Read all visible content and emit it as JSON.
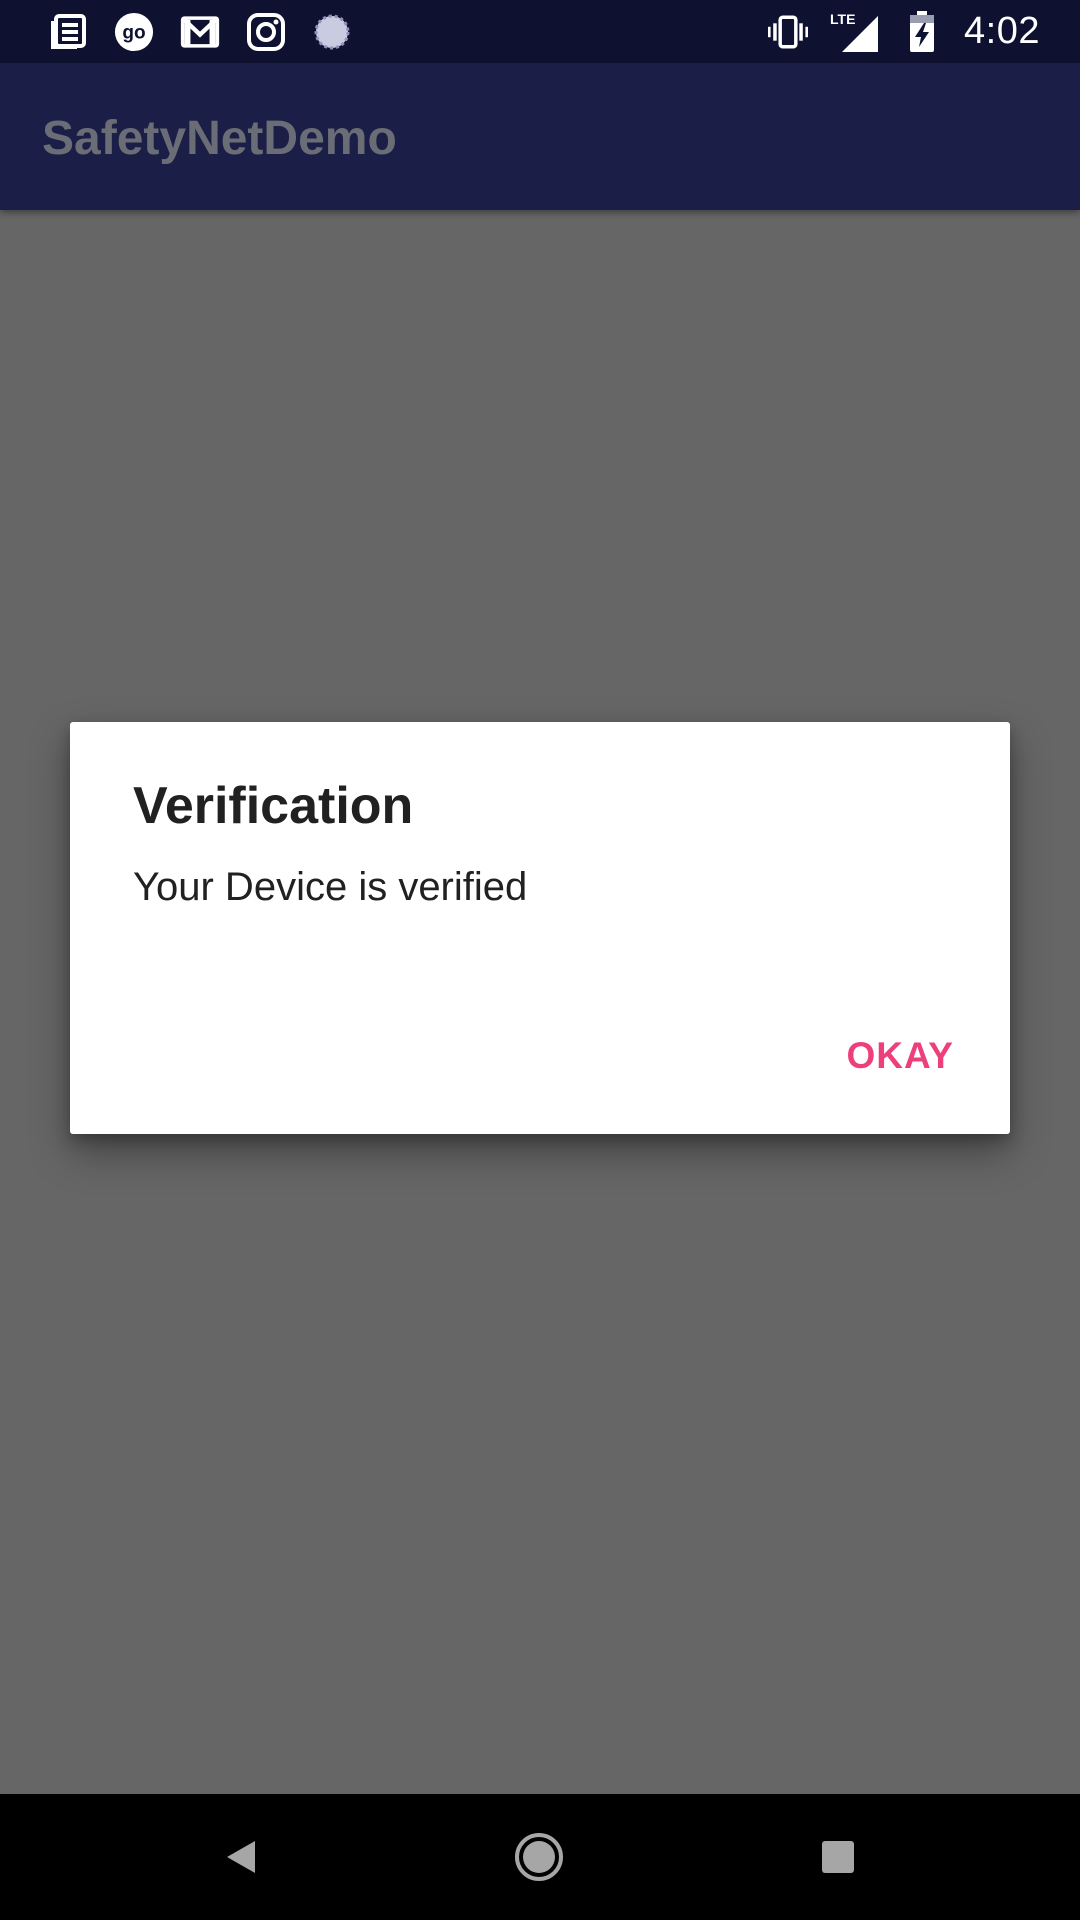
{
  "status_bar": {
    "time": "4:02",
    "network_label": "LTE",
    "notification_icons": [
      "news-icon",
      "go-icon",
      "gmail-icon",
      "instagram-icon",
      "sync-spinner-icon"
    ],
    "system_icons": [
      "vibrate-icon",
      "lte-signal-icon",
      "battery-charging-icon"
    ]
  },
  "app_bar": {
    "title": "SafetyNetDemo"
  },
  "dialog": {
    "title": "Verification",
    "message": "Your Device is verified",
    "positive_button": "OKAY",
    "button_color": "#ee3f7d"
  },
  "nav_bar": {
    "buttons": [
      "back-icon",
      "home-icon",
      "recents-icon"
    ]
  },
  "colors": {
    "status_bar": "#0e1230",
    "app_bar": "#1b1f47",
    "scrim": "#666666",
    "nav_bar": "#000000"
  }
}
